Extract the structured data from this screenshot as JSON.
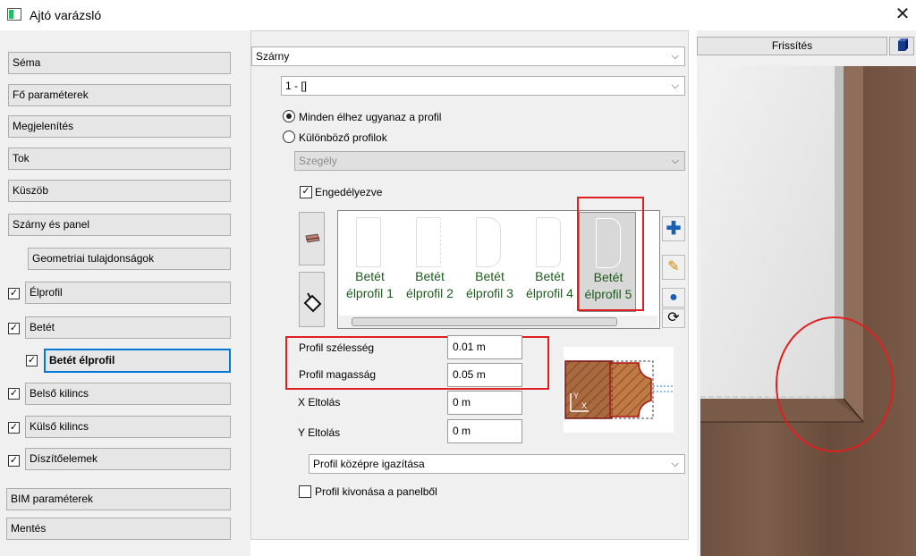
{
  "window": {
    "title": "Ajtó varázsló",
    "close": "✕"
  },
  "nav": {
    "items": [
      {
        "label": "Séma"
      },
      {
        "label": "Fő paraméterek"
      },
      {
        "label": "Megjelenítés"
      },
      {
        "label": "Tok"
      },
      {
        "label": "Küszöb"
      },
      {
        "label": "Szárny és panel"
      },
      {
        "label": "Geometriai tulajdonságok"
      },
      {
        "label": "Élprofil",
        "checked": true
      },
      {
        "label": "Betét",
        "checked": true
      },
      {
        "label": "Betét élprofil",
        "checked": true,
        "selected": true
      },
      {
        "label": "Belső kilincs",
        "checked": true
      },
      {
        "label": "Külső kilincs",
        "checked": true
      },
      {
        "label": "Díszítőelemek",
        "checked": true
      },
      {
        "label": "BIM paraméterek"
      },
      {
        "label": "Mentés"
      }
    ]
  },
  "mid": {
    "section_combo": "Szárny",
    "element_combo": "1 - []",
    "radio_same": "Minden élhez ugyanaz a profil",
    "radio_diff": "Különböző profilok",
    "edge_combo": "Szegély",
    "enabled_label": "Engedélyezve",
    "profiles": [
      {
        "line1": "Betét",
        "line2": "élprofil 1"
      },
      {
        "line1": "Betét",
        "line2": "élprofil 2"
      },
      {
        "line1": "Betét",
        "line2": "élprofil 3"
      },
      {
        "line1": "Betét",
        "line2": "élprofil 4"
      },
      {
        "line1": "Betét",
        "line2": "élprofil 5"
      }
    ],
    "width_label": "Profil szélesség",
    "width_value": "0.01 m",
    "height_label": "Profil magasság",
    "height_value": "0.05 m",
    "xoff_label": "X Eltolás",
    "xoff_value": "0 m",
    "yoff_label": "Y Eltolás",
    "yoff_value": "0 m",
    "align_combo": "Profil középre igazítása",
    "subtract_label": "Profil kivonása a panelből",
    "diagram_x": "X",
    "diagram_y": "Y"
  },
  "right": {
    "refresh_label": "Frissítés"
  },
  "colors": {
    "highlight": "#e02020",
    "wood": "#7a5a45",
    "profile_caption": "#1e5a1e"
  }
}
